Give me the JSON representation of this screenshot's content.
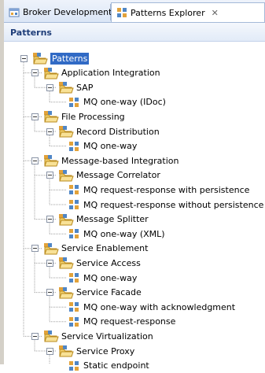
{
  "tabs": [
    {
      "label": "Broker Development",
      "icon": "broker-dev-icon"
    },
    {
      "label": "Patterns Explorer",
      "icon": "patterns-explorer-icon",
      "close": "✕"
    }
  ],
  "header": {
    "title": "Patterns"
  },
  "tree": [
    {
      "label": "Patterns",
      "kind": "folder",
      "level": 0,
      "selected": true
    },
    {
      "label": "Application Integration",
      "kind": "folder",
      "level": 1
    },
    {
      "label": "SAP",
      "kind": "folder",
      "level": 2
    },
    {
      "label": "MQ one-way (IDoc)",
      "kind": "pattern",
      "level": 3
    },
    {
      "label": "File Processing",
      "kind": "folder",
      "level": 1
    },
    {
      "label": "Record Distribution",
      "kind": "folder",
      "level": 2
    },
    {
      "label": "MQ one-way",
      "kind": "pattern",
      "level": 3
    },
    {
      "label": "Message-based Integration",
      "kind": "folder",
      "level": 1
    },
    {
      "label": "Message Correlator",
      "kind": "folder",
      "level": 2
    },
    {
      "label": "MQ request-response with persistence",
      "kind": "pattern",
      "level": 3
    },
    {
      "label": "MQ request-response without persistence",
      "kind": "pattern",
      "level": 3
    },
    {
      "label": "Message Splitter",
      "kind": "folder",
      "level": 2
    },
    {
      "label": "MQ one-way (XML)",
      "kind": "pattern",
      "level": 3
    },
    {
      "label": "Service Enablement",
      "kind": "folder",
      "level": 1
    },
    {
      "label": "Service Access",
      "kind": "folder",
      "level": 2
    },
    {
      "label": "MQ one-way",
      "kind": "pattern",
      "level": 3
    },
    {
      "label": "Service Facade",
      "kind": "folder",
      "level": 2
    },
    {
      "label": "MQ one-way with acknowledgment",
      "kind": "pattern",
      "level": 3
    },
    {
      "label": "MQ request-response",
      "kind": "pattern",
      "level": 3
    },
    {
      "label": "Service Virtualization",
      "kind": "folder",
      "level": 1
    },
    {
      "label": "Service Proxy",
      "kind": "folder",
      "level": 2
    },
    {
      "label": "Static endpoint",
      "kind": "pattern",
      "level": 3
    }
  ]
}
